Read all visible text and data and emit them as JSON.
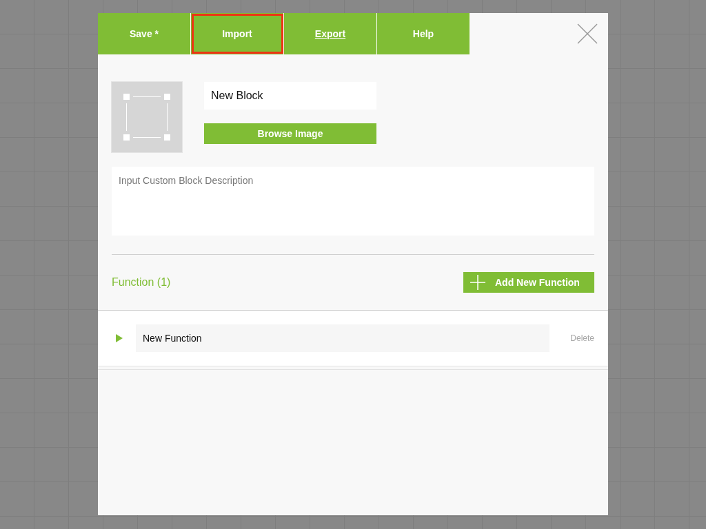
{
  "tabs": [
    {
      "label": "Save *",
      "selected": false,
      "underlined": false
    },
    {
      "label": "Import",
      "selected": true,
      "underlined": false
    },
    {
      "label": "Export",
      "selected": false,
      "underlined": true
    },
    {
      "label": "Help",
      "selected": false,
      "underlined": false
    }
  ],
  "block_name": {
    "value": "New Block"
  },
  "browse_button": "Browse Image",
  "description": {
    "placeholder": "Input Custom Block Description"
  },
  "functions_header": {
    "title": "Function (1)",
    "add_button": "Add New Function"
  },
  "functions": [
    {
      "name": "New Function",
      "expanded": false,
      "delete_label": "Delete",
      "delete_disabled": true
    }
  ]
}
